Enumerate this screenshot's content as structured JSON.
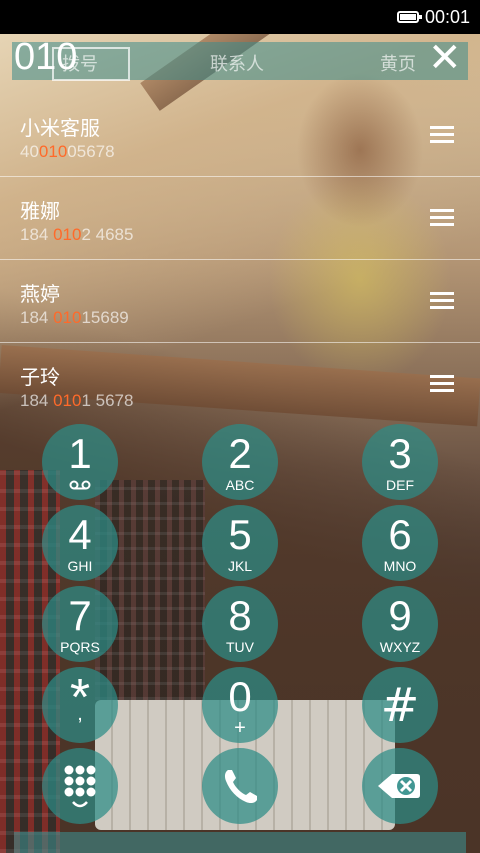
{
  "status": {
    "time": "00:01"
  },
  "header": {
    "dialed": "010",
    "tabs": [
      "拨号",
      "联系人",
      "黄页"
    ],
    "close_glyph": "✕"
  },
  "contacts": [
    {
      "name": "小米客服",
      "num_before": "40",
      "num_match": "010",
      "num_after": "05678"
    },
    {
      "name": "雅娜",
      "num_before": "184 ",
      "num_match": "010",
      "num_after": "2 4685"
    },
    {
      "name": "燕婷",
      "num_before": "184 ",
      "num_match": "010",
      "num_after": "15689"
    },
    {
      "name": "子玲",
      "num_before": "184 ",
      "num_match": "010",
      "num_after": "1 5678"
    }
  ],
  "keypad": [
    {
      "digit": "1",
      "letters": "oo"
    },
    {
      "digit": "2",
      "letters": "ABC"
    },
    {
      "digit": "3",
      "letters": "DEF"
    },
    {
      "digit": "4",
      "letters": "GHI"
    },
    {
      "digit": "5",
      "letters": "JKL"
    },
    {
      "digit": "6",
      "letters": "MNO"
    },
    {
      "digit": "7",
      "letters": "PQRS"
    },
    {
      "digit": "8",
      "letters": "TUV"
    },
    {
      "digit": "9",
      "letters": "WXYZ"
    },
    {
      "digit": "*",
      "letters": ","
    },
    {
      "digit": "0",
      "letters": "+"
    },
    {
      "digit": "#",
      "letters": ""
    }
  ],
  "actions": {
    "keypad_toggle_icon": "dialpad-icon",
    "call_icon": "phone-icon",
    "delete_icon": "backspace-icon"
  }
}
